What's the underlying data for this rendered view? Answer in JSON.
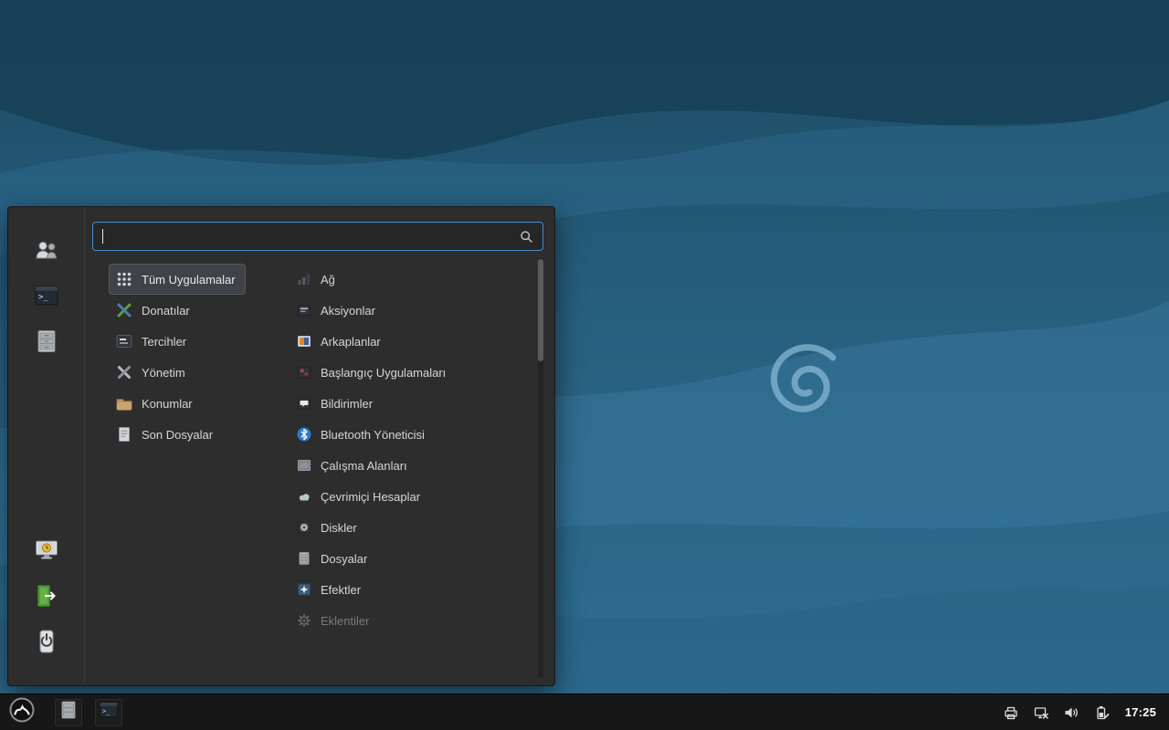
{
  "wallpaper": {
    "style": "blue-wave-abstract",
    "logo": "debian-swirl",
    "base_color": "#27607f",
    "swirl_color": "#86b7d3"
  },
  "menu": {
    "search": {
      "value": "",
      "placeholder": ""
    },
    "favorites": [
      {
        "name": "users",
        "icon": "users-icon"
      },
      {
        "name": "terminal",
        "icon": "terminal-icon"
      },
      {
        "name": "file-manager",
        "icon": "file-cabinet-icon"
      }
    ],
    "session": [
      {
        "name": "lock-screen",
        "icon": "lock-screen-icon"
      },
      {
        "name": "logout",
        "icon": "logout-icon"
      },
      {
        "name": "shutdown",
        "icon": "shutdown-icon"
      }
    ],
    "categories": [
      {
        "label": "Tüm Uygulamalar",
        "icon": "all-applications-icon",
        "selected": true
      },
      {
        "label": "Donatılar",
        "icon": "accessories-icon",
        "selected": false
      },
      {
        "label": "Tercihler",
        "icon": "preferences-icon",
        "selected": false
      },
      {
        "label": "Yönetim",
        "icon": "administration-icon",
        "selected": false
      },
      {
        "label": "Konumlar",
        "icon": "places-icon",
        "selected": false
      },
      {
        "label": "Son Dosyalar",
        "icon": "recent-files-icon",
        "selected": false
      }
    ],
    "apps": [
      {
        "label": "Ağ",
        "icon": "network-icon",
        "disabled": false
      },
      {
        "label": "Aksiyonlar",
        "icon": "actions-icon",
        "disabled": false
      },
      {
        "label": "Arkaplanlar",
        "icon": "backgrounds-icon",
        "disabled": false
      },
      {
        "label": "Başlangıç Uygulamaları",
        "icon": "startup-applications-icon",
        "disabled": false
      },
      {
        "label": "Bildirimler",
        "icon": "notifications-icon",
        "disabled": false
      },
      {
        "label": "Bluetooth Yöneticisi",
        "icon": "bluetooth-icon",
        "disabled": false
      },
      {
        "label": "Çalışma Alanları",
        "icon": "workspaces-icon",
        "disabled": false
      },
      {
        "label": "Çevrimiçi Hesaplar",
        "icon": "online-accounts-icon",
        "disabled": false
      },
      {
        "label": "Diskler",
        "icon": "disks-icon",
        "disabled": false
      },
      {
        "label": "Dosyalar",
        "icon": "files-icon",
        "disabled": false
      },
      {
        "label": "Efektler",
        "icon": "effects-icon",
        "disabled": false
      },
      {
        "label": "Eklentiler",
        "icon": "extensions-icon",
        "disabled": true
      }
    ]
  },
  "panel": {
    "launchers": [
      {
        "name": "file-manager",
        "icon": "file-cabinet-icon"
      },
      {
        "name": "terminal",
        "icon": "terminal-icon"
      }
    ],
    "tray": [
      {
        "name": "printer",
        "icon": "printer-icon"
      },
      {
        "name": "network-offline",
        "icon": "network-offline-icon"
      },
      {
        "name": "volume",
        "icon": "volume-icon"
      },
      {
        "name": "battery",
        "icon": "battery-icon"
      }
    ],
    "clock": "17:25"
  }
}
